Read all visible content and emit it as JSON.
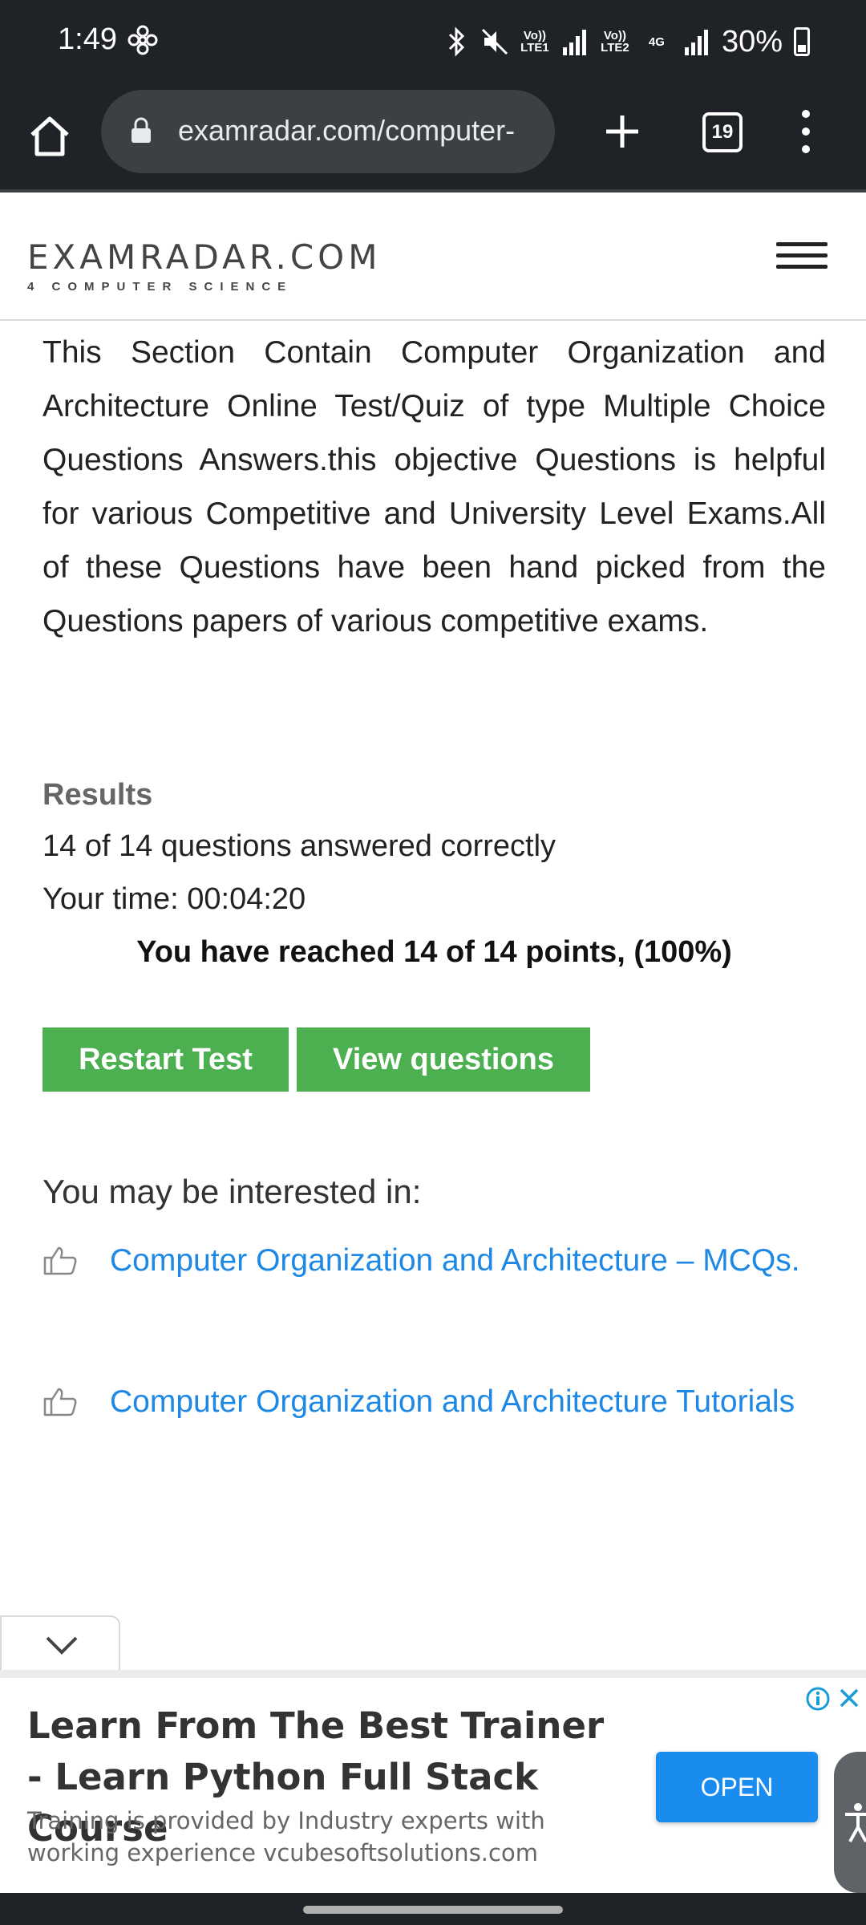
{
  "status_bar": {
    "time": "1:49",
    "net1": "Vo)) LTE1",
    "net2": "Vo)) LTE2",
    "net_4g": "4G",
    "battery": "30%"
  },
  "browser": {
    "url": "examradar.com/computer-",
    "tab_count": "19"
  },
  "site": {
    "logo_main": "EXAMRADAR.COM",
    "logo_sub": "4 COMPUTER SCIENCE"
  },
  "content": {
    "intro": "This Section Contain Computer Organization and Architecture Online Test/Quiz of type Multiple Choice Questions Answers.this objective Questions is helpful for various Competitive and University Level Exams.All of these Questions have been hand picked from the Questions papers of various competitive exams.",
    "results_heading": "Results",
    "results_correct": "14 of 14 questions answered correctly",
    "results_time": "Your time: 00:04:20",
    "results_points": "You have reached 14 of 14 points, (100%)",
    "restart_label": "Restart Test",
    "view_label": "View questions",
    "interest_heading": "You may be interested in:",
    "related": [
      {
        "label": "Computer Organization and Architecture – MCQs."
      },
      {
        "label": "Computer Organization and Architecture Tutorials"
      }
    ]
  },
  "ad": {
    "title": "Learn From The Best Trainer - Learn Python Full Stack Course",
    "description": "Training is provided by Industry experts with working experience vcubesoftsolutions.com",
    "open_label": "OPEN"
  },
  "colors": {
    "accent_green": "#4caf50",
    "link_blue": "#1e88e5",
    "ad_button_blue": "#1a8cf0",
    "chrome_dark": "#1f2226"
  }
}
